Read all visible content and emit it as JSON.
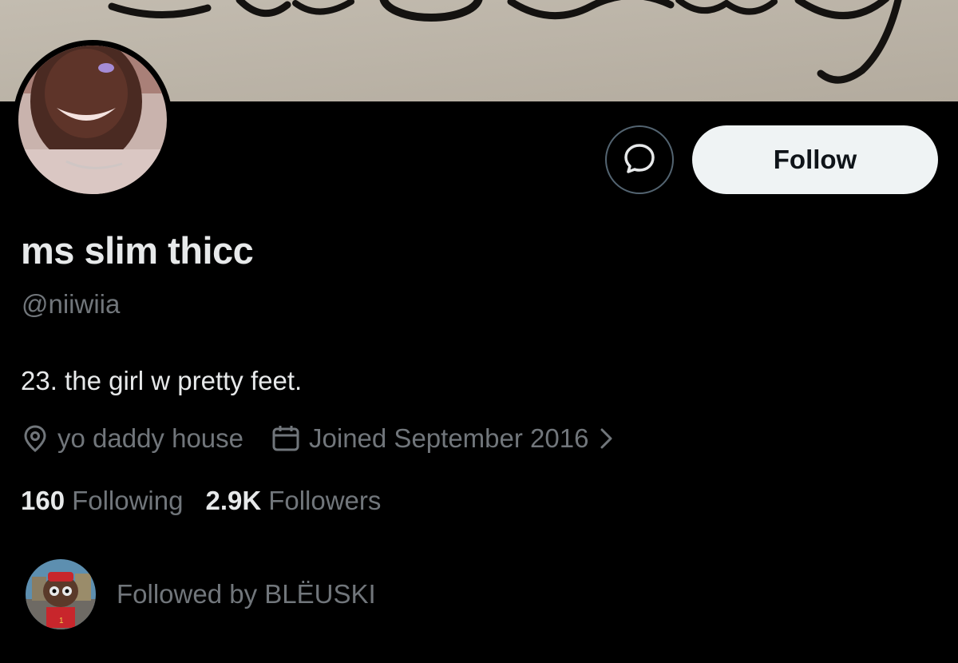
{
  "banner": {
    "script_text": "The Only"
  },
  "profile": {
    "display_name": "ms slim thicc",
    "handle": "@niiwiia",
    "bio": "23. the girl w pretty feet.",
    "location": "yo daddy house",
    "joined": "Joined September 2016"
  },
  "actions": {
    "follow_label": "Follow"
  },
  "stats": {
    "following_count": "160",
    "following_label": "Following",
    "followers_count": "2.9K",
    "followers_label": "Followers"
  },
  "followed_by": {
    "text": "Followed by BLËUSKI"
  },
  "icons": {
    "message": "message-icon",
    "location": "location-pin-icon",
    "calendar": "calendar-icon",
    "chevron": "chevron-right-icon"
  },
  "colors": {
    "background": "#000000",
    "primary_text": "#e7e9ea",
    "secondary_text": "#71767b",
    "follow_button_bg": "#eff3f4",
    "border": "#536471"
  }
}
